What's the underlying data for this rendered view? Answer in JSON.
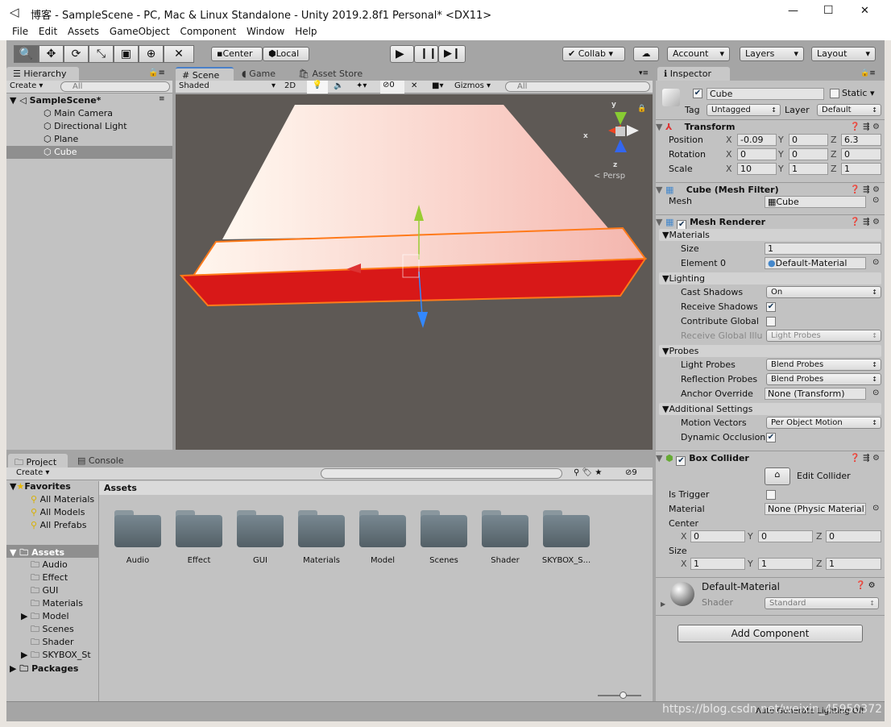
{
  "window": {
    "title": "博客 - SampleScene - PC, Mac & Linux Standalone - Unity 2019.2.8f1 Personal* <DX11>",
    "minimize": "—",
    "maximize": "☐",
    "close": "✕"
  },
  "menu": [
    "File",
    "Edit",
    "Assets",
    "GameObject",
    "Component",
    "Window",
    "Help"
  ],
  "toolbar": {
    "tools": [
      "search-icon",
      "move-icon",
      "rotate-icon",
      "scale-icon",
      "rect-icon",
      "transform-icon",
      "custom-tool-icon"
    ],
    "pivot": "Center",
    "space": "Local",
    "collab": "Collab",
    "account": "Account",
    "layers": "Layers",
    "layout": "Layout"
  },
  "hierarchy": {
    "tab": "Hierarchy",
    "create": "Create",
    "search": "All",
    "scene": "SampleScene*",
    "items": [
      "Main Camera",
      "Directional Light",
      "Plane",
      "Cube"
    ],
    "selected": "Cube"
  },
  "scene": {
    "tabs": [
      "Scene",
      "Game",
      "Asset Store"
    ],
    "shading": "Shaded",
    "mode_2d": "2D",
    "hidden_count": "0",
    "gizmos": "Gizmos",
    "search": "All",
    "persp": "Persp",
    "axis_x": "x",
    "axis_y": "y",
    "axis_z": "z"
  },
  "inspector": {
    "tab": "Inspector",
    "name": "Cube",
    "static": "Static",
    "tag_label": "Tag",
    "tag": "Untagged",
    "layer_label": "Layer",
    "layer": "Default",
    "transform": {
      "title": "Transform",
      "rows": [
        {
          "label": "Position",
          "x": "-0.09",
          "y": "0",
          "z": "6.3"
        },
        {
          "label": "Rotation",
          "x": "0",
          "y": "0",
          "z": "0"
        },
        {
          "label": "Scale",
          "x": "10",
          "y": "1",
          "z": "1"
        }
      ]
    },
    "mesh_filter": {
      "title": "Cube (Mesh Filter)",
      "mesh_label": "Mesh",
      "mesh": "Cube"
    },
    "mesh_renderer": {
      "title": "Mesh Renderer",
      "materials": "Materials",
      "size_label": "Size",
      "size": "1",
      "element0_label": "Element 0",
      "element0": "Default-Material",
      "lighting": "Lighting",
      "cast_shadows_label": "Cast Shadows",
      "cast_shadows": "On",
      "receive_shadows_label": "Receive Shadows",
      "contribute_global_label": "Contribute Global",
      "receive_gi_label": "Receive Global Illu",
      "receive_gi": "Light Probes",
      "probes": "Probes",
      "light_probes_label": "Light Probes",
      "light_probes": "Blend Probes",
      "reflection_probes_label": "Reflection Probes",
      "reflection_probes": "Blend Probes",
      "anchor_label": "Anchor Override",
      "anchor": "None (Transform)",
      "additional": "Additional Settings",
      "motion_vectors_label": "Motion Vectors",
      "motion_vectors": "Per Object Motion",
      "dynamic_occlusion_label": "Dynamic Occlusion"
    },
    "box_collider": {
      "title": "Box Collider",
      "edit": "Edit Collider",
      "is_trigger": "Is Trigger",
      "material_label": "Material",
      "material": "None (Physic Material)",
      "center_label": "Center",
      "center": {
        "x": "0",
        "y": "0",
        "z": "0"
      },
      "size_label": "Size",
      "size": {
        "x": "1",
        "y": "1",
        "z": "1"
      }
    },
    "material": {
      "name": "Default-Material",
      "shader_label": "Shader",
      "shader": "Standard"
    },
    "add_component": "Add Component"
  },
  "project": {
    "tabs": [
      "Project",
      "Console"
    ],
    "create": "Create",
    "hidden_count": "9",
    "favorites": "Favorites",
    "fav_items": [
      "All Materials",
      "All Models",
      "All Prefabs"
    ],
    "assets": "Assets",
    "asset_tree": [
      "Audio",
      "Effect",
      "GUI",
      "Materials",
      "Model",
      "Scenes",
      "Shader",
      "SKYBOX_St"
    ],
    "packages": "Packages",
    "header": "Assets",
    "folders": [
      "Audio",
      "Effect",
      "GUI",
      "Materials",
      "Model",
      "Scenes",
      "Shader",
      "SKYBOX_S..."
    ]
  },
  "status": {
    "text": "Auto Generate Lighting Off",
    "watermark": "https://blog.csdn.net/weixin_45950372"
  }
}
